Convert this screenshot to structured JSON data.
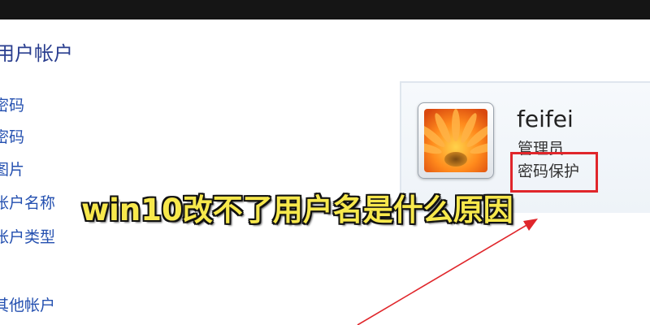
{
  "window": {
    "section_title": "用户帐户"
  },
  "sidebar": {
    "items": [
      {
        "label": "密码"
      },
      {
        "label": "密码"
      },
      {
        "label": "图片"
      },
      {
        "label": "帐户名称"
      },
      {
        "label": "帐户类型"
      },
      {
        "label": "其他帐户"
      }
    ]
  },
  "account": {
    "name": "feifei",
    "role": "管理员",
    "password_status": "密码保护"
  },
  "overlay": {
    "caption": "win10改不了用户名是什么原因"
  },
  "colors": {
    "highlight": "#e0262b",
    "caption": "#f7e84c",
    "link": "#2450b0"
  },
  "icons": {
    "avatar": "orange-flower-avatar"
  }
}
